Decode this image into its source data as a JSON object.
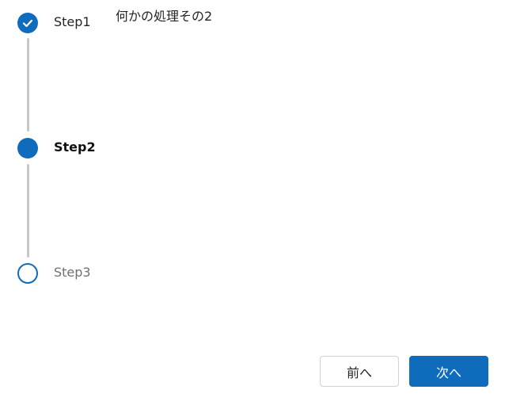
{
  "stepper": {
    "steps": [
      {
        "label": "Step1",
        "state": "completed",
        "icon": "check-icon"
      },
      {
        "label": "Step2",
        "state": "current"
      },
      {
        "label": "Step3",
        "state": "upcoming"
      }
    ]
  },
  "content": {
    "text": "何かの処理その2"
  },
  "footer": {
    "prev_label": "前へ",
    "next_label": "次へ"
  },
  "colors": {
    "accent": "#0f6cbd",
    "connector": "#c8c8c8",
    "muted_text": "#707070"
  }
}
